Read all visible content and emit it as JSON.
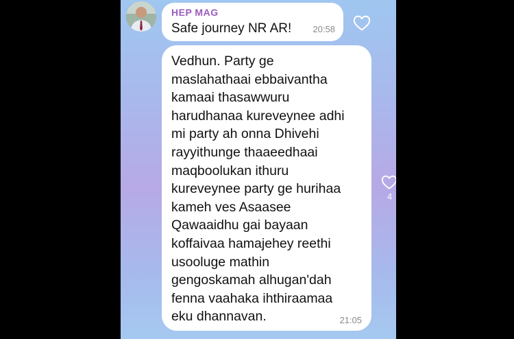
{
  "messages": [
    {
      "sender": "HEP MAG",
      "text": "Safe journey NR AR!",
      "time": "20:58"
    },
    {
      "text": "Vedhun. Party ge\nmaslahathaai ebbaivantha\nkamaai thasawwuru\nharudhanaa kureveynee adhi\nmi party ah onna Dhivehi\nrayyithunge thaaeedhaai\nmaqboolukan ithuru\nkureveynee party ge hurihaa\nkameh ves Asaasee\nQawaaidhu gai bayaan\nkoffaivaa hamajehey reethi\nusooluge mathin\ngengoskamah alhugan'dah\nfenna vaahaka ihthiraamaa\neku dhannavan.",
      "time": "21:05",
      "like_count": "4"
    }
  ],
  "colors": {
    "sender": "#9b5bbd",
    "bubble": "#ffffff",
    "timestamp": "#8a8a8a"
  },
  "icons": {
    "like": "heart-outline-icon",
    "avatar": "sender-avatar"
  }
}
